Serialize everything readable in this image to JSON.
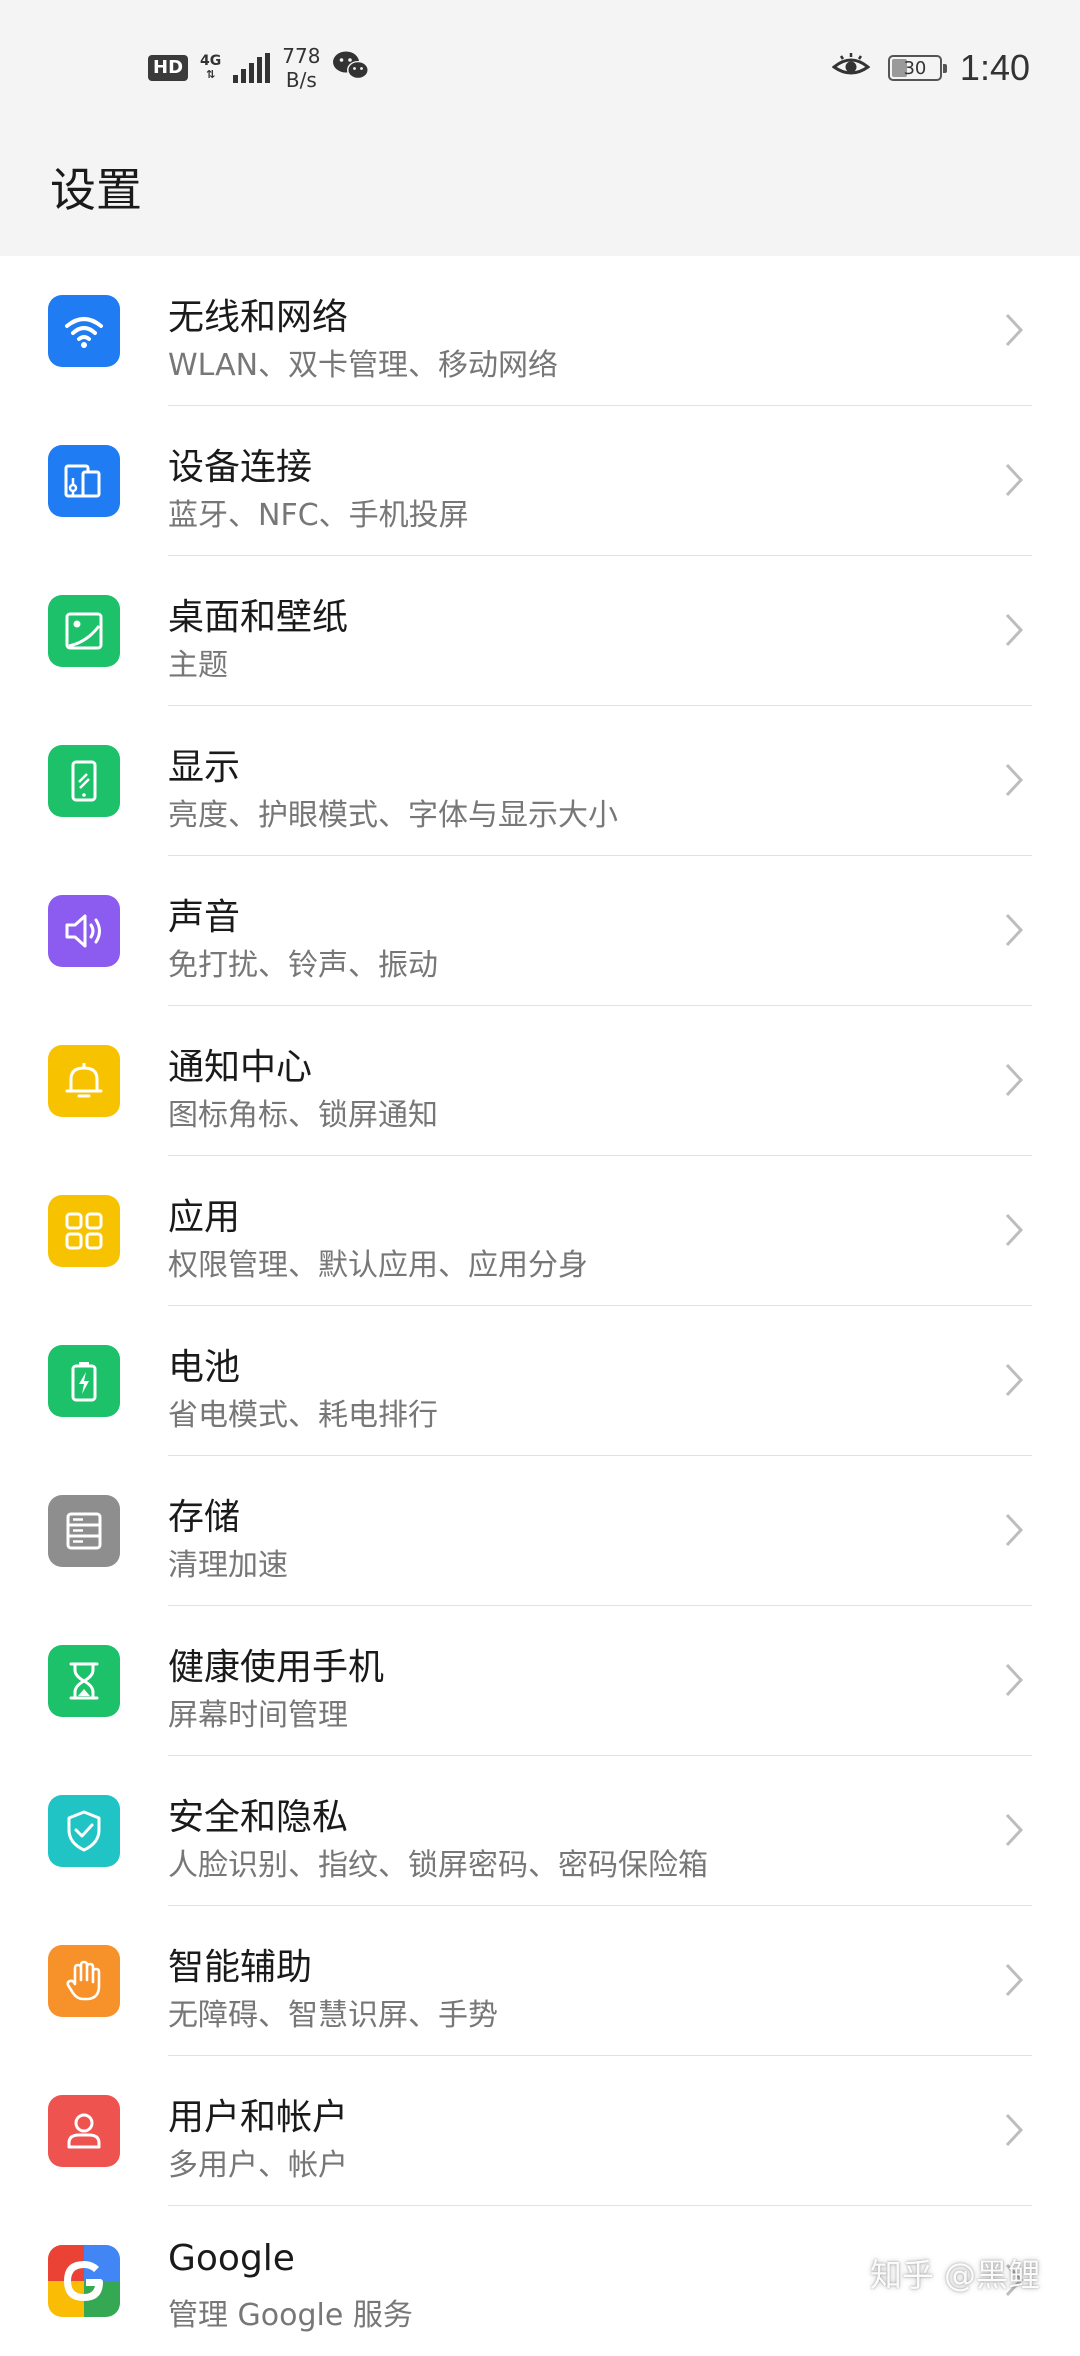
{
  "status_bar": {
    "hd": "HD",
    "network": "4G",
    "speed_value": "778",
    "speed_unit": "B/s",
    "battery_level": "30",
    "time": "1:40",
    "icons": [
      "hd-icon",
      "signal-icon",
      "wechat-icon",
      "eye-comfort-icon",
      "battery-icon"
    ]
  },
  "header": {
    "title": "设置"
  },
  "settings": [
    {
      "key": "wireless",
      "title": "无线和网络",
      "subtitle": "WLAN、双卡管理、移动网络",
      "icon": "wifi-icon",
      "color": "#1f7cf2"
    },
    {
      "key": "device",
      "title": "设备连接",
      "subtitle": "蓝牙、NFC、手机投屏",
      "icon": "device-connection-icon",
      "color": "#1f7cf2"
    },
    {
      "key": "home",
      "title": "桌面和壁纸",
      "subtitle": "主题",
      "icon": "wallpaper-icon",
      "color": "#1cc169"
    },
    {
      "key": "display",
      "title": "显示",
      "subtitle": "亮度、护眼模式、字体与显示大小",
      "icon": "display-icon",
      "color": "#1cc169"
    },
    {
      "key": "sound",
      "title": "声音",
      "subtitle": "免打扰、铃声、振动",
      "icon": "speaker-icon",
      "color": "#8c5cf0"
    },
    {
      "key": "notification",
      "title": "通知中心",
      "subtitle": "图标角标、锁屏通知",
      "icon": "bell-icon",
      "color": "#f7c300"
    },
    {
      "key": "apps",
      "title": "应用",
      "subtitle": "权限管理、默认应用、应用分身",
      "icon": "apps-grid-icon",
      "color": "#f7c300"
    },
    {
      "key": "battery",
      "title": "电池",
      "subtitle": "省电模式、耗电排行",
      "icon": "battery-charge-icon",
      "color": "#1cc169"
    },
    {
      "key": "storage",
      "title": "存储",
      "subtitle": "清理加速",
      "icon": "storage-icon",
      "color": "#8e8e8e"
    },
    {
      "key": "digital_balance",
      "title": "健康使用手机",
      "subtitle": "屏幕时间管理",
      "icon": "hourglass-icon",
      "color": "#1cc169"
    },
    {
      "key": "security",
      "title": "安全和隐私",
      "subtitle": "人脸识别、指纹、锁屏密码、密码保险箱",
      "icon": "shield-icon",
      "color": "#21c4c4"
    },
    {
      "key": "smart_assist",
      "title": "智能辅助",
      "subtitle": "无障碍、智慧识屏、手势",
      "icon": "hand-icon",
      "color": "#f7922b"
    },
    {
      "key": "accounts",
      "title": "用户和帐户",
      "subtitle": "多用户、帐户",
      "icon": "user-icon",
      "color": "#ef5350"
    },
    {
      "key": "google",
      "title": "Google",
      "subtitle": "管理 Google 服务",
      "icon": "google-icon",
      "color": "#ffffff"
    }
  ],
  "watermark": "知乎 @黑鲤"
}
